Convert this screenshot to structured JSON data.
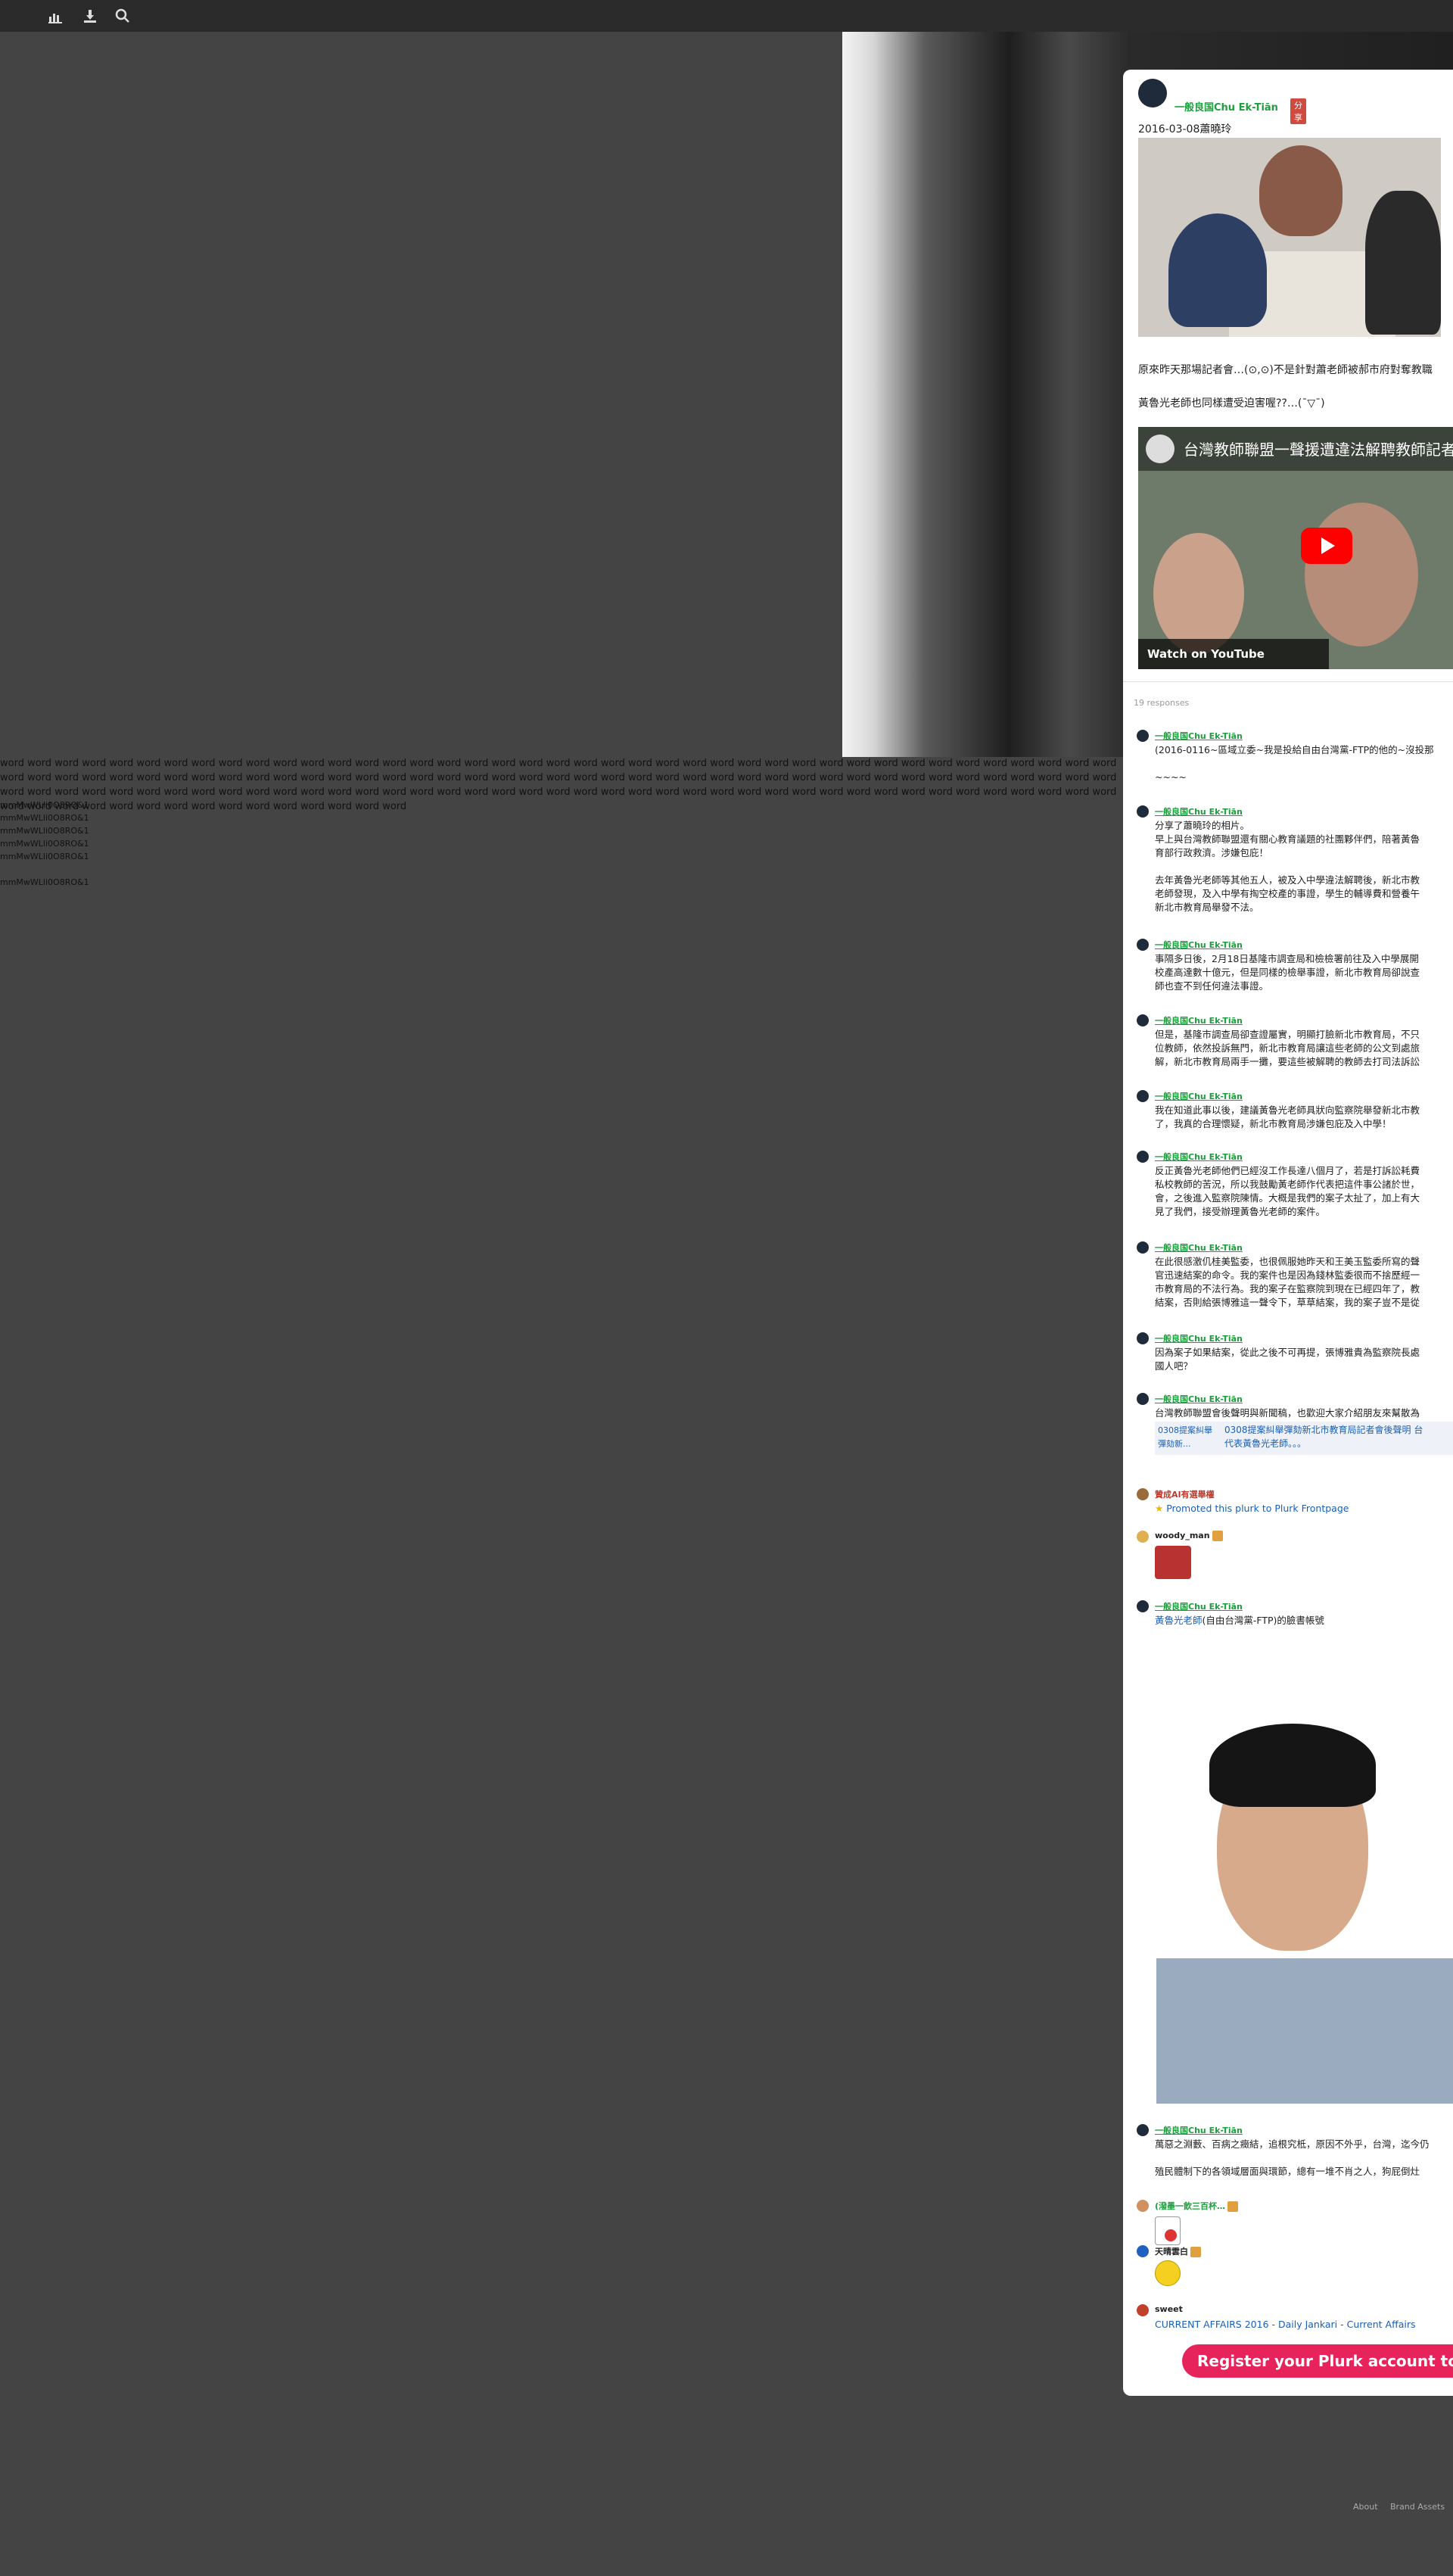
{
  "topbar": {
    "icons": [
      "chart-icon",
      "download-icon",
      "search-icon"
    ]
  },
  "overflow": {
    "words": "word word word word word word word word word word word word word word word word word word word word word word word word word word word word word word word word word word word word word word word word word word word word word word word word word word word word word word word word word word word word word word word word word word word word word word word word word word word word word word word word word word word word word word word word word word word word word word word word word word word word word word word word word word word word word word word word word word word word word word word word word word word word word word word word word word word word word word word word word word",
    "codes": [
      "mmMwWLli0O8RO&1",
      "mmMwWLli0O8RO&1",
      "mmMwWLli0O8RO&1",
      "mmMwWLli0O8RO&1",
      "mmMwWLli0O8RO&1",
      "",
      "mmMwWLli0O8RO&1"
    ]
  },
  "post": {
    "author": "一般良国Chu Ek-Tiān",
    "share_badge": "分享",
    "line1": "2016-03-08蕭曉玲",
    "line2": "原來昨天那場記者會…(⊙,⊙)不是針對蕭老師被郝市府對奪教職",
    "line3": "黃魯光老師也同樣遭受迫害喔??…(¯▽¯)",
    "video_title": "台灣教師聯盟一聲援遭違法解聘教師記者會",
    "watch_on": "Watch on  YouTube",
    "responses_count": "19 responses"
  },
  "responses": [
    {
      "name": "一般良国Chu Ek-Tiān",
      "lines": [
        "(2016-0116~區域立委~我是投給自由台灣黨-FTP的他的~沒投那",
        "",
        "~~~~"
      ]
    },
    {
      "name": "一般良国Chu Ek-Tiān",
      "lines": [
        "分享了蕭曉玲的相片。",
        "早上與台灣教師聯盟還有關心教育議題的社團夥伴們，陪著黃魯",
        "育部行政救濟。涉嫌包庇！",
        "",
        "去年黃魯光老師等其他五人，被及入中學違法解聘後，新北市教",
        "老師發現，及入中學有掏空校產的事證，學生的輔導費和營養午",
        "新北市教育局舉發不法。"
      ]
    },
    {
      "name": "一般良国Chu Ek-Tiān",
      "lines": [
        "事隔多日後，2月18日基隆市調查局和檢檢署前往及入中學展開",
        "校產高達數十億元，但是同樣的檢舉事證，新北市教育局卻說查",
        "師也查不到任何違法事證。"
      ]
    },
    {
      "name": "一般良国Chu Ek-Tiān",
      "lines": [
        "但是，基隆市調查局卻查證屬實，明顯打臉新北市教育局，不只",
        "位教師，依然投訴無門，新北市教育局讓這些老師的公文到處旅",
        "解，新北市教育局兩手一攤，要這些被解聘的教師去打司法訴訟"
      ]
    },
    {
      "name": "一般良国Chu Ek-Tiān",
      "lines": [
        "我在知道此事以後，建議黃魯光老師具狀向監察院舉發新北市教",
        "了，我真的合理懷疑，新北市教育局涉嫌包庇及入中學！"
      ]
    },
    {
      "name": "一般良国Chu Ek-Tiān",
      "lines": [
        "反正黃魯光老師他們已經沒工作長達八個月了，若是打訴訟耗費",
        "私校教師的苦況，所以我鼓勵黃老師作代表把這件事公諸於世，",
        "會，之後進入監察院陳情。大概是我們的案子太扯了，加上有大",
        "見了我們，接受辦理黃魯光老師的案件。"
      ]
    },
    {
      "name": "一般良国Chu Ek-Tiān",
      "lines": [
        "在此很感激仉桂美監委，也很佩服她昨天和王美玉監委所寫的聲",
        "官迅速結案的命令。我的案件也是因為錢林監委很而不捨歷經一",
        "市教育局的不法行為。我的案子在監察院到現在已經四年了，教",
        "結案，否則給張博雅這一聲令下，草草結案，我的案子豈不是從"
      ]
    },
    {
      "name": "一般良国Chu Ek-Tiān",
      "lines": [
        "因為案子如果結案，從此之後不可再提，張博雅貴為監察院長處",
        "國人吧？"
      ]
    },
    {
      "name": "一般良国Chu Ek-Tiān",
      "lines": [
        "台灣教師聯盟會後聲明與新聞稿，也歡迎大家介紹朋友來幫散為"
      ],
      "link_lines": [
        "0308提案糾舉彈劾新北市教育局記者會後聲明 台",
        "代表黃魯光老師。。。"
      ],
      "link_thumb": "0308提案糾舉彈劾新..."
    },
    {
      "name": "贊成AI有選舉權",
      "promoted": "Promoted this plurk to Plurk Frontpage"
    },
    {
      "name": "woody_man"
    },
    {
      "name": "一般良国Chu Ek-Tiān",
      "link": "黃魯光老師",
      "after_link": "(自由台灣黨-FTP)的臉書帳號"
    },
    {
      "name": "一般良国Chu Ek-Tiān",
      "lines": [
        "萬惡之淵藪、百病之癥結，追根究柢，原因不外乎，台灣，迄今仍",
        "",
        "殖民體制下的各領域層面與環節，總有一堆不肖之人，狗屁倒灶"
      ]
    },
    {
      "name": "(潑墨一飲三百杯…"
    },
    {
      "name": "天晴雲白"
    },
    {
      "name": "sweet",
      "link": "CURRENT AFFAIRS 2016 - Daily Jankari - Current Affairs"
    }
  ],
  "cta": "Register your Plurk account to respond",
  "footer": {
    "about": "About",
    "brand": "Brand Assets"
  },
  "colors": {
    "accent": "#e6245b",
    "author": "#1e9e3e",
    "link": "#1a5fb4"
  }
}
